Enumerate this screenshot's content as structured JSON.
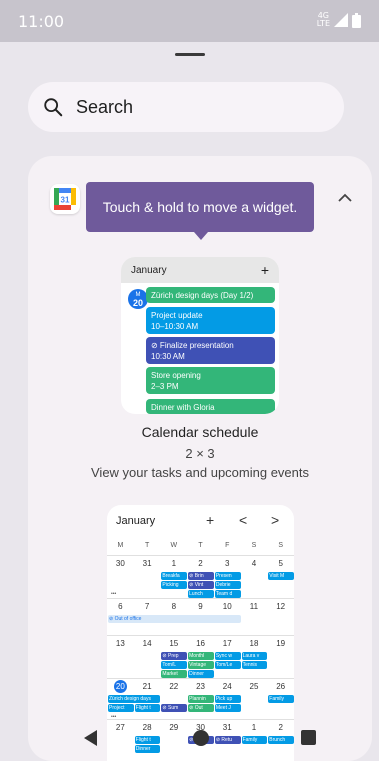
{
  "status": {
    "time": "11:00",
    "network": "4G\nLTE"
  },
  "search": {
    "label": "Search"
  },
  "tooltip": {
    "text": "Touch & hold to move a widget."
  },
  "app_icon": {
    "text": "31"
  },
  "widget1": {
    "header": "January",
    "plus": "+",
    "date_day": "M",
    "date_num": "20",
    "events": [
      {
        "title": "Zürich design days (Day 1/2)",
        "time": "",
        "color": "#33b679"
      },
      {
        "title": "Project update",
        "time": "10–10:30 AM",
        "color": "#039be5"
      },
      {
        "title": "⊘ Finalize presentation",
        "time": "10:30 AM",
        "color": "#3f51b5"
      },
      {
        "title": "Store opening",
        "time": "2–3 PM",
        "color": "#33b679"
      },
      {
        "title": "Dinner with Gloria",
        "time": "",
        "color": "#33b679"
      }
    ],
    "name": "Calendar schedule",
    "size": "2 × 3",
    "desc": "View your tasks and upcoming events"
  },
  "widget2": {
    "title": "January",
    "plus": "+",
    "prev": "<",
    "next": ">",
    "dow": [
      "M",
      "T",
      "W",
      "T",
      "F",
      "S",
      "S"
    ],
    "weeks": [
      {
        "days": [
          "30",
          "31",
          "1",
          "2",
          "3",
          "4",
          "5"
        ],
        "chips": [
          {
            "col": 2,
            "row": 0,
            "text": "Breakfa",
            "color": "c-teal"
          },
          {
            "col": 2,
            "row": 1,
            "text": "Picking",
            "color": "c-teal"
          },
          {
            "col": 3,
            "row": 0,
            "text": "⊘ Brin",
            "color": "c-ind"
          },
          {
            "col": 3,
            "row": 1,
            "text": "⊘ Vint",
            "color": "c-ind"
          },
          {
            "col": 3,
            "row": 2,
            "text": "Lunch",
            "color": "c-teal"
          },
          {
            "col": 4,
            "row": 0,
            "text": "Presen",
            "color": "c-teal"
          },
          {
            "col": 4,
            "row": 1,
            "text": "Debrie",
            "color": "c-teal"
          },
          {
            "col": 4,
            "row": 2,
            "text": "Team d",
            "color": "c-teal"
          },
          {
            "col": 6,
            "row": 0,
            "text": "Visit M",
            "color": "c-teal"
          }
        ],
        "more": "•••"
      },
      {
        "days": [
          "6",
          "7",
          "8",
          "9",
          "10",
          "11",
          "12"
        ],
        "chips": [
          {
            "col": 0,
            "row": 0,
            "span": 5,
            "text": "⊘ Out of office",
            "color": "c-oof"
          }
        ]
      },
      {
        "days": [
          "13",
          "14",
          "15",
          "16",
          "17",
          "18",
          "19"
        ],
        "chips": [
          {
            "col": 2,
            "row": 0,
            "text": "⊘ Prep",
            "color": "c-ind"
          },
          {
            "col": 2,
            "row": 1,
            "text": "Tom/L",
            "color": "c-teal"
          },
          {
            "col": 2,
            "row": 2,
            "text": "Market",
            "color": "c-green"
          },
          {
            "col": 3,
            "row": 0,
            "text": "Monthl",
            "color": "c-green"
          },
          {
            "col": 3,
            "row": 1,
            "text": "Vintage",
            "color": "c-green"
          },
          {
            "col": 3,
            "row": 2,
            "text": "Dinner",
            "color": "c-teal"
          },
          {
            "col": 4,
            "row": 0,
            "text": "Sync w",
            "color": "c-teal"
          },
          {
            "col": 4,
            "row": 1,
            "text": "Tom/Le",
            "color": "c-teal"
          },
          {
            "col": 5,
            "row": 0,
            "text": "Laura v",
            "color": "c-teal"
          },
          {
            "col": 5,
            "row": 1,
            "text": "Tennis",
            "color": "c-teal"
          }
        ]
      },
      {
        "days": [
          "20",
          "21",
          "22",
          "23",
          "24",
          "25",
          "26"
        ],
        "chips": [
          {
            "col": 0,
            "row": 0,
            "span": 2,
            "text": "Zürich design days",
            "color": "c-teal"
          },
          {
            "col": 0,
            "row": 1,
            "text": "Project",
            "color": "c-teal"
          },
          {
            "col": 1,
            "row": 1,
            "text": "Flight t",
            "color": "c-teal"
          },
          {
            "col": 2,
            "row": 1,
            "text": "⊘ Sum",
            "color": "c-ind"
          },
          {
            "col": 3,
            "row": 0,
            "text": "Plannin",
            "color": "c-green"
          },
          {
            "col": 3,
            "row": 1,
            "text": "⊘ Out",
            "color": "c-oofg"
          },
          {
            "col": 4,
            "row": 0,
            "text": "Pick up",
            "color": "c-teal"
          },
          {
            "col": 4,
            "row": 1,
            "text": "Meet J",
            "color": "c-teal"
          },
          {
            "col": 6,
            "row": 0,
            "text": "Family",
            "color": "c-teal"
          }
        ],
        "more": "•••"
      },
      {
        "days": [
          "27",
          "28",
          "29",
          "30",
          "31",
          "1",
          "2"
        ],
        "chips": [
          {
            "col": 1,
            "row": 0,
            "text": "Flight t",
            "color": "c-teal"
          },
          {
            "col": 1,
            "row": 1,
            "text": "Dinner",
            "color": "c-teal"
          },
          {
            "col": 3,
            "row": 0,
            "text": "⊘ Upd",
            "color": "c-ind"
          },
          {
            "col": 4,
            "row": 0,
            "text": "⊘ Retu",
            "color": "c-ind"
          },
          {
            "col": 5,
            "row": 0,
            "text": "Family",
            "color": "c-teal"
          },
          {
            "col": 6,
            "row": 0,
            "text": "Brunch",
            "color": "c-teal"
          }
        ]
      }
    ]
  }
}
